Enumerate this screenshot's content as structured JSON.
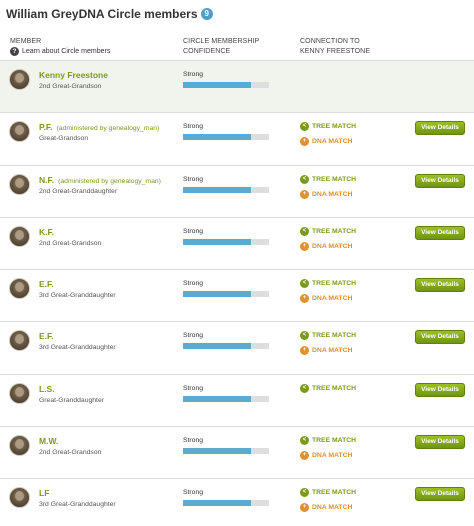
{
  "header": {
    "title": "William GreyDNA Circle members",
    "count": "9"
  },
  "columns": {
    "member": "MEMBER",
    "learn_link": "Learn about Circle members",
    "confidence_line1": "CIRCLE MEMBERSHIP",
    "confidence_line2": "CONFIDENCE",
    "connection_line1": "CONNECTION TO",
    "connection_line2": "KENNY FREESTONE"
  },
  "labels": {
    "tree_match": "TREE MATCH",
    "dna_match": "DNA MATCH",
    "view_details": "View Details"
  },
  "icons": {
    "help": "question-icon",
    "tree": "share-icon",
    "dna": "plus-icon",
    "avatar": "avatar-photo"
  },
  "colors": {
    "accent_green": "#7a9a1b",
    "bar_blue": "#5aabcf",
    "dna_orange": "#e0902e",
    "badge_blue": "#4f9fc8"
  },
  "members": [
    {
      "name": "Kenny Freestone",
      "admin": "",
      "relation": "2nd Great-Grandson",
      "confidence": "Strong",
      "confidence_level": 0.79,
      "tree_match": false,
      "dna_match": false,
      "details": false,
      "highlight": true
    },
    {
      "name": "P.F.",
      "admin": "(administered by genealogy_man)",
      "relation": "Great-Grandson",
      "confidence": "Strong",
      "confidence_level": 0.79,
      "tree_match": true,
      "dna_match": true,
      "details": true,
      "highlight": false
    },
    {
      "name": "N.F.",
      "admin": "(administered by genealogy_man)",
      "relation": "2nd Great-Granddaughter",
      "confidence": "Strong",
      "confidence_level": 0.79,
      "tree_match": true,
      "dna_match": true,
      "details": true,
      "highlight": false
    },
    {
      "name": "K.F.",
      "admin": "",
      "relation": "2nd Great-Grandson",
      "confidence": "Strong",
      "confidence_level": 0.79,
      "tree_match": true,
      "dna_match": true,
      "details": true,
      "highlight": false
    },
    {
      "name": "E.F.",
      "admin": "",
      "relation": "3rd Great-Granddaughter",
      "confidence": "Strong",
      "confidence_level": 0.79,
      "tree_match": true,
      "dna_match": true,
      "details": true,
      "highlight": false
    },
    {
      "name": "E.F.",
      "admin": "",
      "relation": "3rd Great-Granddaughter",
      "confidence": "Strong",
      "confidence_level": 0.79,
      "tree_match": true,
      "dna_match": true,
      "details": true,
      "highlight": false
    },
    {
      "name": "L.S.",
      "admin": "",
      "relation": "Great-Granddaughter",
      "confidence": "Strong",
      "confidence_level": 0.79,
      "tree_match": true,
      "dna_match": false,
      "details": true,
      "highlight": false
    },
    {
      "name": "M.W.",
      "admin": "",
      "relation": "2nd Great-Grandson",
      "confidence": "Strong",
      "confidence_level": 0.79,
      "tree_match": true,
      "dna_match": true,
      "details": true,
      "highlight": false
    },
    {
      "name": "LF",
      "admin": "",
      "relation": "3rd Great-Granddaughter",
      "confidence": "Strong",
      "confidence_level": 0.79,
      "tree_match": true,
      "dna_match": true,
      "details": true,
      "highlight": false
    }
  ]
}
